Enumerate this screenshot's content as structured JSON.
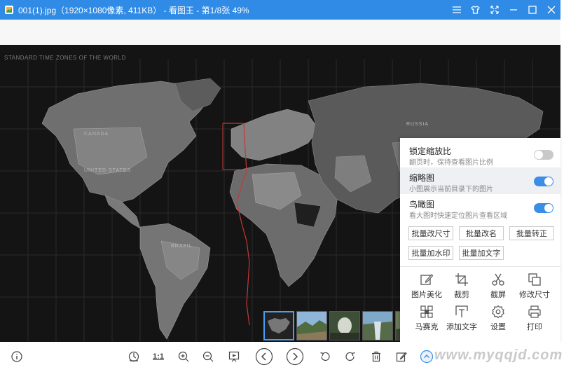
{
  "window": {
    "title": "001(1).jpg（1920×1080像素, 411KB） - 看图王 - 第1/8张 49%",
    "controls": [
      "menu-icon",
      "skin-icon",
      "fullscreen-icon",
      "minimize-icon",
      "maximize-icon",
      "close-icon"
    ]
  },
  "image": {
    "map_title": "STANDARD TIME ZONES OF THE WORLD",
    "labels": [
      "CANADA",
      "UNITED STATES",
      "BRAZIL",
      "RUSSIA"
    ]
  },
  "popup": {
    "settings": [
      {
        "title": "锁定缩放比",
        "desc": "翻页时，保持查看图片比例",
        "on": false
      },
      {
        "title": "缩略图",
        "desc": "小图展示当前目录下的图片",
        "on": true
      },
      {
        "title": "鸟瞰图",
        "desc": "看大图时快速定位图片查看区域",
        "on": true
      }
    ],
    "batch_buttons": [
      "批量改尺寸",
      "批量改名",
      "批量转正",
      "批量加水印",
      "批量加文字"
    ],
    "tools": [
      {
        "label": "图片美化",
        "icon": "edit-icon"
      },
      {
        "label": "裁剪",
        "icon": "crop-icon"
      },
      {
        "label": "截屏",
        "icon": "scissors-icon"
      },
      {
        "label": "修改尺寸",
        "icon": "resize-icon"
      },
      {
        "label": "马赛克",
        "icon": "mosaic-icon"
      },
      {
        "label": "添加文字",
        "icon": "add-text-icon"
      },
      {
        "label": "设置",
        "icon": "gear-icon"
      },
      {
        "label": "打印",
        "icon": "printer-icon"
      }
    ]
  },
  "bottombar": {
    "actual_size_label": "1:1",
    "buttons": [
      "info-icon",
      "fit-icon",
      "actual-size",
      "zoom-in-icon",
      "zoom-out-icon",
      "slideshow-icon",
      "prev-icon",
      "next-icon",
      "rotate-left-icon",
      "rotate-right-icon",
      "delete-icon",
      "edit-icon",
      "more-icon"
    ]
  },
  "thumbnails": {
    "count": 5,
    "active_index": 0
  },
  "watermark": "www.myqqjd.com",
  "colors": {
    "titlebar": "#2f8be6",
    "accent": "#3a8ee6",
    "canvas": "#141414"
  }
}
